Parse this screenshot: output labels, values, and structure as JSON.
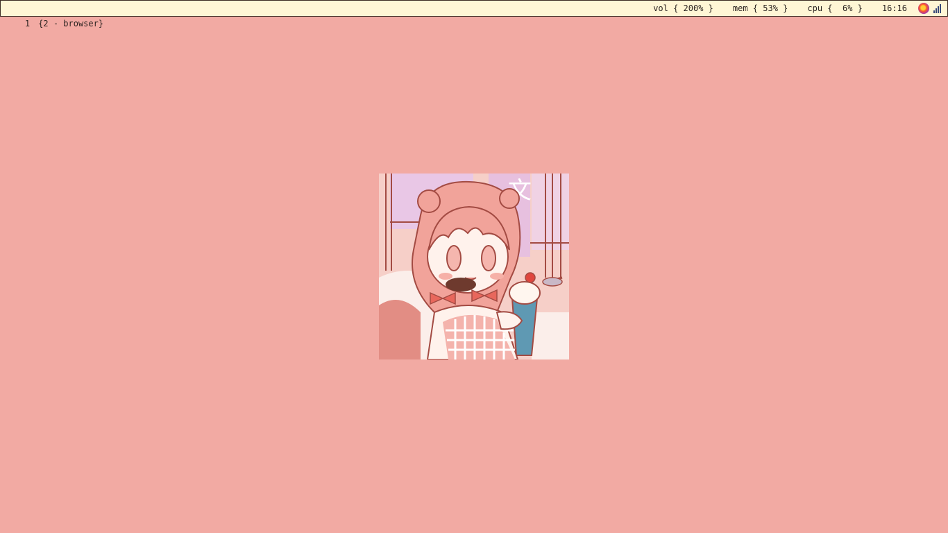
{
  "bar": {
    "workspace_number": "1",
    "workspace_title": "{2 - browser}",
    "vol": "vol { 200% }",
    "mem": "mem { 53% }",
    "cpu": "cpu {  6% }",
    "clock": "16:16"
  },
  "tray": {
    "icons": [
      "firefox-icon",
      "network-signal-icon"
    ]
  },
  "wallpaper": {
    "background_color": "#f2aaa3",
    "art_subject": "anime-girl-with-ice-cream"
  }
}
